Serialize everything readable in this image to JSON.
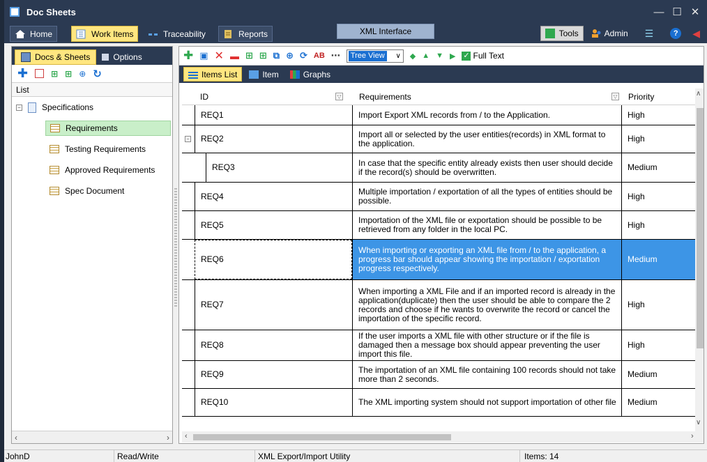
{
  "window": {
    "title": "Doc Sheets",
    "controls": [
      "—",
      "☐",
      "✕"
    ]
  },
  "menu": {
    "tabs": [
      {
        "label": "Home"
      },
      {
        "label": "Work Items"
      },
      {
        "label": "Traceability"
      },
      {
        "label": "Reports"
      }
    ],
    "context_tab": "XML Interface",
    "tools_label": "Tools",
    "admin_label": "Admin"
  },
  "left_panel": {
    "tabs": [
      "Docs & Sheets",
      "Options"
    ],
    "list_label": "List",
    "tree": {
      "root": "Specifications",
      "children": [
        "Requirements",
        "Testing Requirements",
        "Approved Requirements",
        "Spec Document"
      ]
    }
  },
  "toolbar": {
    "view_mode": "Tree View",
    "full_text_label": "Full Text"
  },
  "views": {
    "tabs": [
      "Items List",
      "Item",
      "Graphs"
    ]
  },
  "grid": {
    "columns": {
      "id": "ID",
      "requirements": "Requirements",
      "priority": "Priority"
    },
    "rows": [
      {
        "id": "REQ1",
        "text": "Import Export XML records from / to the Application.",
        "priority": "High"
      },
      {
        "id": "REQ2",
        "text": "Import all or selected by the user entities(records) in XML format  to the application.",
        "priority": "High"
      },
      {
        "id": "REQ3",
        "text": "In case that the specific entity already exists then user should decide if the record(s) should be overwritten.",
        "priority": "Medium"
      },
      {
        "id": "REQ4",
        "text": "Multiple importation / exportation of all the types of entities should be possible.",
        "priority": "High"
      },
      {
        "id": "REQ5",
        "text": "Importation of the XML file or exportation should be possible to be retrieved from any folder in the local PC.",
        "priority": "High"
      },
      {
        "id": "REQ6",
        "text": "When importing or exporting an XML file from / to the application, a progress bar should appear showing the importation / exportation progress respectively.",
        "priority": "Medium"
      },
      {
        "id": "REQ7",
        "text": "When importing a XML File and if an imported record is already in the application(duplicate) then the user should be able to compare the 2 records and choose if he wants to overwrite the record or cancel the importation of the specific record.",
        "priority": "High"
      },
      {
        "id": "REQ8",
        "text": "If the user imports a XML file with other structure or if the file is damaged then a message box should appear preventing the user import this file.",
        "priority": "High"
      },
      {
        "id": "REQ9",
        "text": "The importation of an XML file containing 100 records should not take more than 2 seconds.",
        "priority": "Medium"
      },
      {
        "id": "REQ10",
        "text": "The XML importing system should not support importation of other file",
        "priority": "Medium"
      }
    ]
  },
  "status": {
    "user": "JohnD",
    "mode": "Read/Write",
    "document": "XML Export/Import Utility",
    "items": "Items: 14"
  },
  "colors": {
    "chrome": "#2b3a52",
    "active_tab": "#ffe680",
    "selection": "#3d95e6",
    "tree_selection": "#c9efc9"
  }
}
